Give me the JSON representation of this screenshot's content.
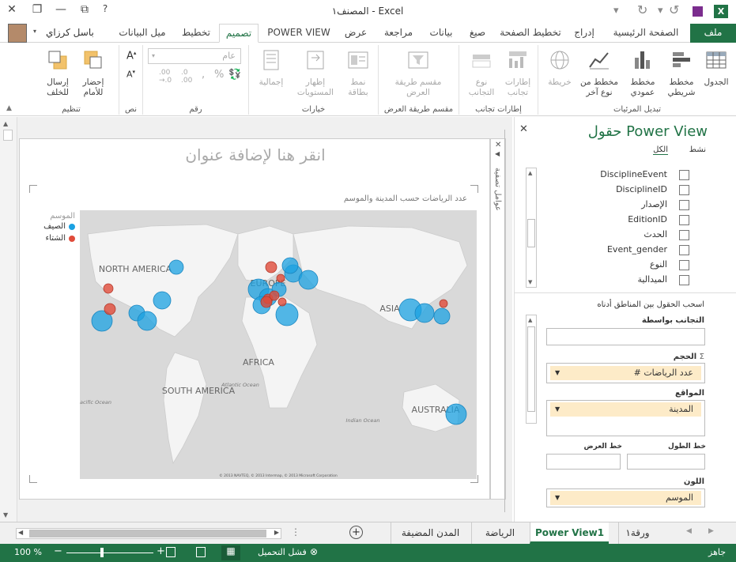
{
  "titlebar": {
    "title": "المصنف١ - Excel",
    "help": "?"
  },
  "quick_access": [
    "save-icon",
    "undo-icon",
    "redo-icon"
  ],
  "tabs": {
    "file": "ملف",
    "home": "الصفحة الرئيسية",
    "insert": "إدراج",
    "page_layout": "تخطيط الصفحة",
    "formulas": "صيغ",
    "data": "بيانات",
    "review": "مراجعة",
    "view": "عرض",
    "power_view": "POWER VIEW",
    "design": "تصميم",
    "layout": "تخطيط",
    "trendline": "ميل البيانات",
    "user": "باسل كرزاي"
  },
  "ribbon": {
    "switch_viz": {
      "label": "تبديل المرئيات",
      "table": "الجدول",
      "bar": "مخطط شريطي",
      "column": "مخطط عمودي",
      "other": "مخطط من نوع آخر",
      "map": "خريطة"
    },
    "tiles": {
      "label": "إطارات تجانب",
      "tiles": "إطارات تجانب",
      "tile_type": "نوع التجانب"
    },
    "slicer": {
      "label": "مقسم طريقة العرض",
      "slicer": "مقسم طريقة العرض"
    },
    "options": {
      "label": "خيارات",
      "card_style": "نمط بطاقة",
      "show_levels": "إظهار المستويات",
      "totals": "إجمالية"
    },
    "number": {
      "label": "رقم",
      "format": "عام"
    },
    "text": {
      "label": "نص"
    },
    "arrange": {
      "label": "تنظيم",
      "bring_forward": "إحضار للأمام",
      "send_backward": "إرسال للخلف"
    }
  },
  "view": {
    "title_placeholder": "انقر هنا لإضافة عنوان",
    "chart_title": "عدد الرياضات حسب المدينة والموسم",
    "filters": "عوامل تصفية",
    "legend_title": "الموسم",
    "legend": [
      {
        "label": "الصيف",
        "color": "#1ba1e2"
      },
      {
        "label": "الشتاء",
        "color": "#e04b3a"
      }
    ],
    "map_labels": [
      "NORTH AMERICA",
      "EUROPE",
      "ASIA",
      "AFRICA",
      "SOUTH AMERICA",
      "AUSTRALIA"
    ],
    "map_small_labels": [
      "Atlantic Ocean",
      "Pacific Ocean",
      "Indian Ocean"
    ],
    "credit": "© 2013 NAVTEQ, © 2013 Intermap, © 2013 Microsoft Corporation"
  },
  "fields": {
    "title": "حقول Power View",
    "tab_active": "نشط",
    "tab_all": "الكل",
    "list": [
      "DisciplineEvent",
      "DisciplineID",
      "الإصدار",
      "EditionID",
      "الحدث",
      "Event_gender",
      "النوع",
      "الميدالية"
    ],
    "drag_hint": "اسحب الحقول بين المناطق أدناه",
    "tile_by": "التجانب بواسطة",
    "size": "الحجم",
    "size_value": "# عدد الرياضات",
    "locations": "المواقع",
    "locations_value": "المدينة",
    "lat": "خط العرض",
    "lon": "خط الطول",
    "color": "اللون",
    "color_value": "الموسم"
  },
  "sheets": [
    "ورقة١",
    "Power View1",
    "الرياضة",
    "المدن المضيفة"
  ],
  "status": {
    "ready": "جاهز",
    "load_failed": "فشل التحميل",
    "zoom": "100 %"
  }
}
